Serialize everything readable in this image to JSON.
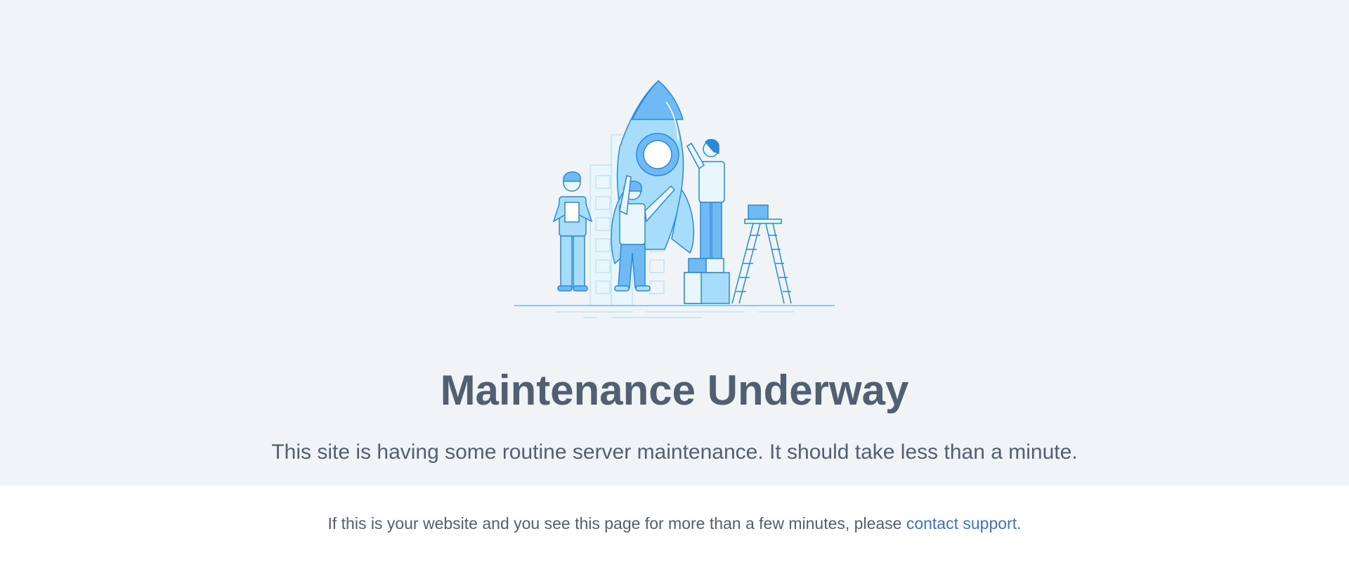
{
  "page": {
    "title": "Maintenance Underway",
    "message": "This site is having some routine server maintenance. It should take less than a minute.",
    "footer_prefix": "If this is your website and you see this page for more than a few minutes, please ",
    "support_link_label": "contact support",
    "footer_suffix": "."
  },
  "illustration": {
    "icon": "rocket-maintenance-illustration"
  },
  "colors": {
    "hero_background": "#f0f4f7",
    "text": "#525f70",
    "link": "#3b73c8",
    "illustration_light": "#a8dcfb",
    "illustration_mid": "#6fbaf5",
    "illustration_stroke": "#2c89d6"
  }
}
